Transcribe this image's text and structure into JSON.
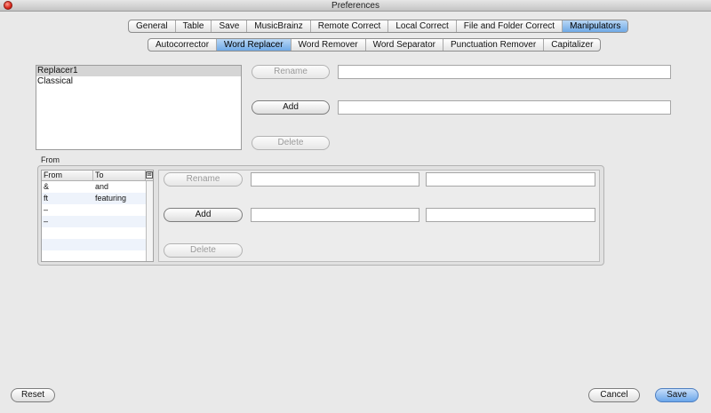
{
  "window": {
    "title": "Preferences"
  },
  "tabs": [
    "General",
    "Table",
    "Save",
    "MusicBrainz",
    "Remote Correct",
    "Local Correct",
    "File and Folder Correct",
    "Manipulators"
  ],
  "active_tab": "Manipulators",
  "subtabs": [
    "Autocorrector",
    "Word Replacer",
    "Word Remover",
    "Word Separator",
    "Punctuation Remover",
    "Capitalizer"
  ],
  "active_subtab": "Word Replacer",
  "replacers": [
    {
      "name": "Replacer1",
      "selected": true
    },
    {
      "name": "Classical",
      "selected": false
    }
  ],
  "replacer_panel": {
    "rename_label": "Rename",
    "add_label": "Add",
    "delete_label": "Delete",
    "rename_value": "",
    "add_value": ""
  },
  "from_group": {
    "label": "From",
    "columns": [
      "From",
      "To"
    ],
    "rows": [
      {
        "from": "&",
        "to": "and"
      },
      {
        "from": "ft",
        "to": "featuring"
      },
      {
        "from": "–",
        "to": ""
      },
      {
        "from": "–",
        "to": ""
      }
    ],
    "rename_label": "Rename",
    "add_label": "Add",
    "delete_label": "Delete"
  },
  "footer": {
    "reset_label": "Reset",
    "cancel_label": "Cancel",
    "save_label": "Save"
  }
}
